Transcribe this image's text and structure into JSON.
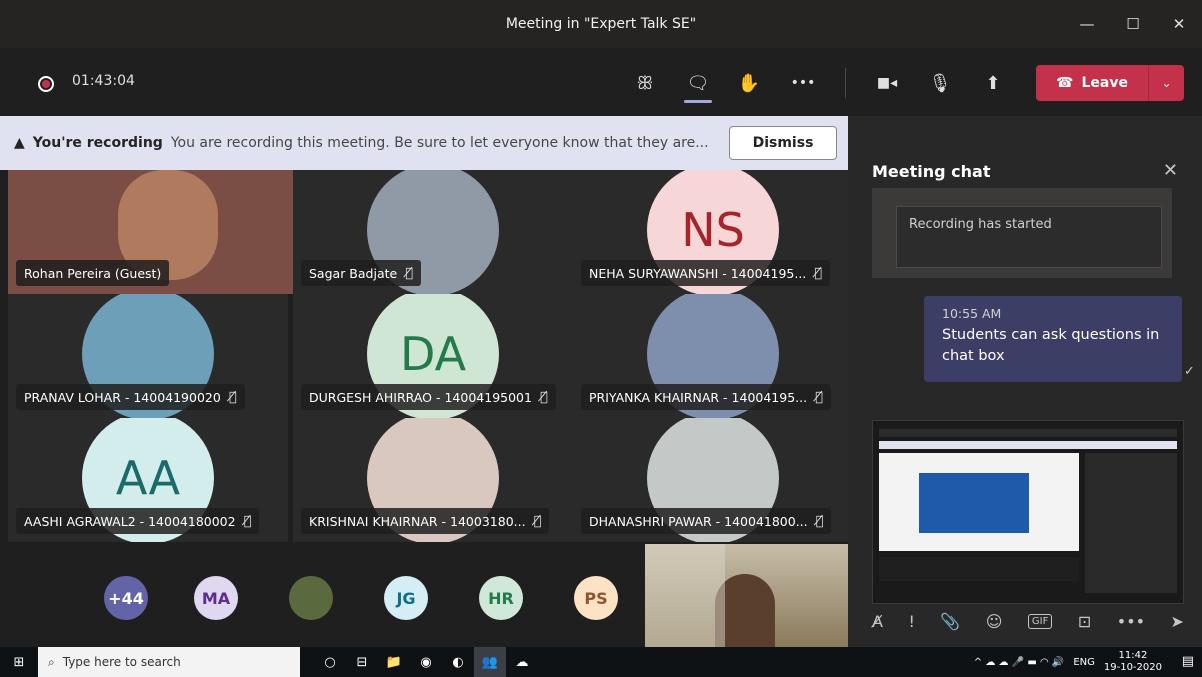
{
  "window": {
    "title": "Meeting in \"Expert Talk SE\"",
    "minimize": "—",
    "maximize": "☐",
    "close": "✕"
  },
  "toolbar": {
    "timer": "01:43:04",
    "participants_icon": "ꕥ",
    "chat_icon": "🗨",
    "hand_icon": "✋",
    "more_icon": "•••",
    "camera_icon": "■◂",
    "mic_icon": "🎙",
    "share_icon": "⬆",
    "leave_label": "Leave",
    "leave_icon": "☎",
    "leave_caret": "⌄"
  },
  "banner": {
    "icon": "▲",
    "title": "You're recording",
    "message": "You are recording this meeting. Be sure to let everyone know that they are...",
    "dismiss": "Dismiss"
  },
  "participants": [
    {
      "name": "Rohan Pereira (Guest)",
      "initials": "",
      "bg": "#7a4e45",
      "muted": false
    },
    {
      "name": "Sagar Badjate",
      "initials": "",
      "bg": "#8f9aa6",
      "muted": true
    },
    {
      "name": "NEHA SURYAWANSHI - 14004195...",
      "initials": "NS",
      "bg": "#f6d6d6",
      "fg": "#a4262c",
      "muted": true
    },
    {
      "name": "PRANAV LOHAR - 14004190020",
      "initials": "",
      "bg": "#6e9fb8",
      "muted": true
    },
    {
      "name": "DURGESH AHIRRAO - 14004195001",
      "initials": "DA",
      "bg": "#cfe6d4",
      "fg": "#237b4b",
      "muted": true
    },
    {
      "name": "PRIYANKA KHAIRNAR - 14004195...",
      "initials": "",
      "bg": "#7e8fae",
      "muted": true
    },
    {
      "name": "AASHI AGRAWAL2 - 14004180002",
      "initials": "AA",
      "bg": "#d3ecec",
      "fg": "#1b6b6a",
      "muted": true
    },
    {
      "name": "KRISHNAI KHAIRNAR - 14003180...",
      "initials": "",
      "bg": "#d9c8c0",
      "muted": true
    },
    {
      "name": "DHANASHRI PAWAR - 140041800...",
      "initials": "",
      "bg": "#c4c9c8",
      "muted": true
    }
  ],
  "mute_icon": "🎙̸",
  "strip": [
    {
      "label": "+44",
      "bg": "#6264a7",
      "fg": "#ffffff"
    },
    {
      "label": "MA",
      "bg": "#e0d7f0",
      "fg": "#5c2e91"
    },
    {
      "label": "",
      "bg": "#5b6a3e",
      "fg": "#ffffff"
    },
    {
      "label": "JG",
      "bg": "#d5edf5",
      "fg": "#0e6f8a"
    },
    {
      "label": "HR",
      "bg": "#cfe8da",
      "fg": "#237b4b"
    },
    {
      "label": "PS",
      "bg": "#fde3c5",
      "fg": "#8e562e"
    }
  ],
  "chat": {
    "title": "Meeting chat",
    "close": "✕",
    "system_message": "Recording has started",
    "message_time": "10:55 AM",
    "message_text": "Students can ask questions in chat box",
    "status_icon": "✓",
    "compose_icons": [
      "A̸",
      "!",
      "📎",
      "☺",
      "GIF",
      "⊡",
      "•••",
      "➤"
    ]
  },
  "taskbar": {
    "start_icon": "⊞",
    "search_placeholder": "Type here to search",
    "search_icon": "⌕",
    "apps": [
      "○",
      "⊟",
      "📁",
      "◉",
      "◐",
      "👥",
      "☁"
    ],
    "tray_icons": "^ ☁ ☁ 🎤 ▬ ◠ 🔊",
    "lang": "ENG",
    "time": "11:42",
    "date": "19-10-2020",
    "notify_icon": "▤"
  }
}
